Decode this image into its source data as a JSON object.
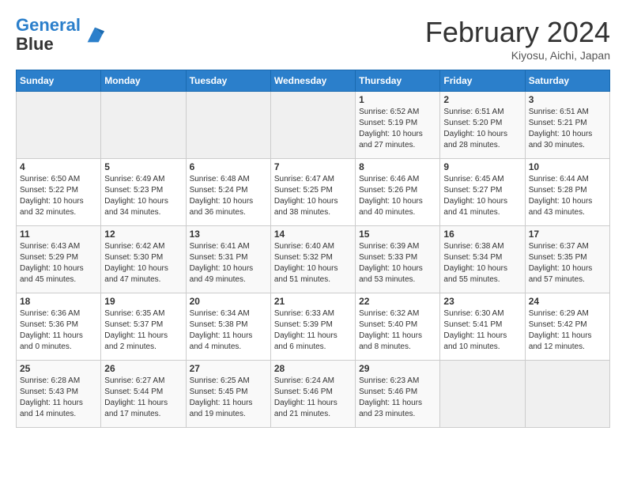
{
  "header": {
    "logo_line1": "General",
    "logo_line2": "Blue",
    "month_year": "February 2024",
    "location": "Kiyosu, Aichi, Japan"
  },
  "days_of_week": [
    "Sunday",
    "Monday",
    "Tuesday",
    "Wednesday",
    "Thursday",
    "Friday",
    "Saturday"
  ],
  "weeks": [
    [
      {
        "day": "",
        "info": ""
      },
      {
        "day": "",
        "info": ""
      },
      {
        "day": "",
        "info": ""
      },
      {
        "day": "",
        "info": ""
      },
      {
        "day": "1",
        "info": "Sunrise: 6:52 AM\nSunset: 5:19 PM\nDaylight: 10 hours and 27 minutes."
      },
      {
        "day": "2",
        "info": "Sunrise: 6:51 AM\nSunset: 5:20 PM\nDaylight: 10 hours and 28 minutes."
      },
      {
        "day": "3",
        "info": "Sunrise: 6:51 AM\nSunset: 5:21 PM\nDaylight: 10 hours and 30 minutes."
      }
    ],
    [
      {
        "day": "4",
        "info": "Sunrise: 6:50 AM\nSunset: 5:22 PM\nDaylight: 10 hours and 32 minutes."
      },
      {
        "day": "5",
        "info": "Sunrise: 6:49 AM\nSunset: 5:23 PM\nDaylight: 10 hours and 34 minutes."
      },
      {
        "day": "6",
        "info": "Sunrise: 6:48 AM\nSunset: 5:24 PM\nDaylight: 10 hours and 36 minutes."
      },
      {
        "day": "7",
        "info": "Sunrise: 6:47 AM\nSunset: 5:25 PM\nDaylight: 10 hours and 38 minutes."
      },
      {
        "day": "8",
        "info": "Sunrise: 6:46 AM\nSunset: 5:26 PM\nDaylight: 10 hours and 40 minutes."
      },
      {
        "day": "9",
        "info": "Sunrise: 6:45 AM\nSunset: 5:27 PM\nDaylight: 10 hours and 41 minutes."
      },
      {
        "day": "10",
        "info": "Sunrise: 6:44 AM\nSunset: 5:28 PM\nDaylight: 10 hours and 43 minutes."
      }
    ],
    [
      {
        "day": "11",
        "info": "Sunrise: 6:43 AM\nSunset: 5:29 PM\nDaylight: 10 hours and 45 minutes."
      },
      {
        "day": "12",
        "info": "Sunrise: 6:42 AM\nSunset: 5:30 PM\nDaylight: 10 hours and 47 minutes."
      },
      {
        "day": "13",
        "info": "Sunrise: 6:41 AM\nSunset: 5:31 PM\nDaylight: 10 hours and 49 minutes."
      },
      {
        "day": "14",
        "info": "Sunrise: 6:40 AM\nSunset: 5:32 PM\nDaylight: 10 hours and 51 minutes."
      },
      {
        "day": "15",
        "info": "Sunrise: 6:39 AM\nSunset: 5:33 PM\nDaylight: 10 hours and 53 minutes."
      },
      {
        "day": "16",
        "info": "Sunrise: 6:38 AM\nSunset: 5:34 PM\nDaylight: 10 hours and 55 minutes."
      },
      {
        "day": "17",
        "info": "Sunrise: 6:37 AM\nSunset: 5:35 PM\nDaylight: 10 hours and 57 minutes."
      }
    ],
    [
      {
        "day": "18",
        "info": "Sunrise: 6:36 AM\nSunset: 5:36 PM\nDaylight: 11 hours and 0 minutes."
      },
      {
        "day": "19",
        "info": "Sunrise: 6:35 AM\nSunset: 5:37 PM\nDaylight: 11 hours and 2 minutes."
      },
      {
        "day": "20",
        "info": "Sunrise: 6:34 AM\nSunset: 5:38 PM\nDaylight: 11 hours and 4 minutes."
      },
      {
        "day": "21",
        "info": "Sunrise: 6:33 AM\nSunset: 5:39 PM\nDaylight: 11 hours and 6 minutes."
      },
      {
        "day": "22",
        "info": "Sunrise: 6:32 AM\nSunset: 5:40 PM\nDaylight: 11 hours and 8 minutes."
      },
      {
        "day": "23",
        "info": "Sunrise: 6:30 AM\nSunset: 5:41 PM\nDaylight: 11 hours and 10 minutes."
      },
      {
        "day": "24",
        "info": "Sunrise: 6:29 AM\nSunset: 5:42 PM\nDaylight: 11 hours and 12 minutes."
      }
    ],
    [
      {
        "day": "25",
        "info": "Sunrise: 6:28 AM\nSunset: 5:43 PM\nDaylight: 11 hours and 14 minutes."
      },
      {
        "day": "26",
        "info": "Sunrise: 6:27 AM\nSunset: 5:44 PM\nDaylight: 11 hours and 17 minutes."
      },
      {
        "day": "27",
        "info": "Sunrise: 6:25 AM\nSunset: 5:45 PM\nDaylight: 11 hours and 19 minutes."
      },
      {
        "day": "28",
        "info": "Sunrise: 6:24 AM\nSunset: 5:46 PM\nDaylight: 11 hours and 21 minutes."
      },
      {
        "day": "29",
        "info": "Sunrise: 6:23 AM\nSunset: 5:46 PM\nDaylight: 11 hours and 23 minutes."
      },
      {
        "day": "",
        "info": ""
      },
      {
        "day": "",
        "info": ""
      }
    ]
  ]
}
